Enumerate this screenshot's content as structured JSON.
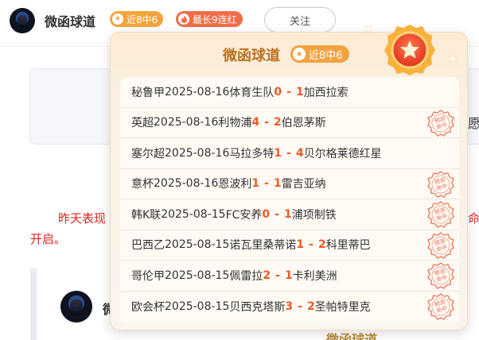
{
  "header": {
    "author_name": "微函球道",
    "streak_badge": "近8中6",
    "longest_badge": "最长9连红",
    "follow_label": "关注"
  },
  "background": {
    "card_edge_char": "愿",
    "notice_line1_start": "昨天表现",
    "notice_line1_end": "命",
    "notice_line2": "开启。",
    "post_author_peek": "微",
    "bottom_peek": "微函球道"
  },
  "popover": {
    "title": "微函球道",
    "badge": "近8中6",
    "stamp_text": "预测命中",
    "records": [
      {
        "league": "秘鲁甲",
        "date": "2025-08-16",
        "home": "体育生队",
        "home_score": "0",
        "away_score": "1",
        "away": "加西拉索",
        "hit": false
      },
      {
        "league": "英超",
        "date": "2025-08-16",
        "home": "利物浦",
        "home_score": "4",
        "away_score": "2",
        "away": "伯恩茅斯",
        "hit": true
      },
      {
        "league": "塞尔超",
        "date": "2025-08-16",
        "home": "马拉多特",
        "home_score": "1",
        "away_score": "4",
        "away": "贝尔格莱德红星",
        "hit": false
      },
      {
        "league": "意杯",
        "date": "2025-08-16",
        "home": "恩波利",
        "home_score": "1",
        "away_score": "1",
        "away": "雷吉亚纳",
        "hit": true
      },
      {
        "league": "韩K联",
        "date": "2025-08-15",
        "home": "FC安养",
        "home_score": "0",
        "away_score": "1",
        "away": "浦项制铁",
        "hit": true
      },
      {
        "league": "巴西乙",
        "date": "2025-08-15",
        "home": "诺瓦里桑蒂诺",
        "home_score": "1",
        "away_score": "2",
        "away": "科里蒂巴",
        "hit": true
      },
      {
        "league": "哥伦甲",
        "date": "2025-08-15",
        "home": "佩雷拉",
        "home_score": "2",
        "away_score": "1",
        "away": "卡利美洲",
        "hit": true
      },
      {
        "league": "欧会杯",
        "date": "2025-08-15",
        "home": "贝西克塔斯",
        "home_score": "3",
        "away_score": "2",
        "away": "圣帕特里克",
        "hit": true
      }
    ]
  },
  "colors": {
    "streak": "#f4a43b",
    "longest": "#f26d47",
    "score": "#f05a28",
    "title": "#b8731f",
    "stamp": "#e4502f"
  }
}
